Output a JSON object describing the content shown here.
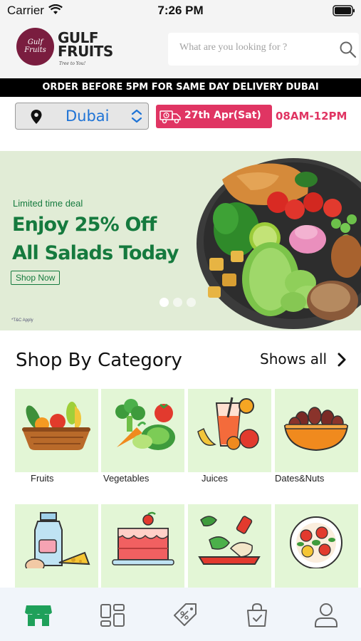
{
  "status_bar": {
    "carrier": "Carrier",
    "time": "7:26 PM"
  },
  "header": {
    "logo_badge": "Gulf Fruits",
    "logo_name": "GULF FRUITS",
    "logo_tagline": "Tree to You!",
    "search_placeholder": "What are you looking for ?"
  },
  "delivery_banner": "ORDER BEFORE 5PM FOR SAME DAY DELIVERY DUBAI",
  "location": {
    "city": "Dubai",
    "date": "27th Apr(Sat)",
    "slot": "08AM-12PM"
  },
  "promo": {
    "kicker": "Limited time deal",
    "title_line1": "Enjoy 25% Off",
    "title_line2": "All Salads Today",
    "button": "Shop Now",
    "tc": "*T&C Apply",
    "slides": 3,
    "active_slide": 1
  },
  "category": {
    "title": "Shop By Category",
    "shows_all": "Shows all",
    "items": [
      {
        "label": "Fruits",
        "icon": "fruit-basket-icon"
      },
      {
        "label": "Vegetables",
        "icon": "vegetables-icon"
      },
      {
        "label": "Juices",
        "icon": "juices-icon"
      },
      {
        "label": "Dates&Nuts",
        "icon": "dates-bowl-icon"
      },
      {
        "label": "",
        "icon": "dairy-icon"
      },
      {
        "label": "",
        "icon": "cake-icon"
      },
      {
        "label": "",
        "icon": "meat-icon"
      },
      {
        "label": "",
        "icon": "salad-plate-icon"
      }
    ]
  },
  "tab_bar": [
    "store-icon",
    "categories-icon",
    "offers-icon",
    "cart-bag-icon",
    "profile-icon"
  ],
  "colors": {
    "brand": "#7a1d3f",
    "accent_pink": "#e03563",
    "promo_green": "#157a3e",
    "link_blue": "#1e73d6",
    "tab_active": "#1fa05a"
  }
}
